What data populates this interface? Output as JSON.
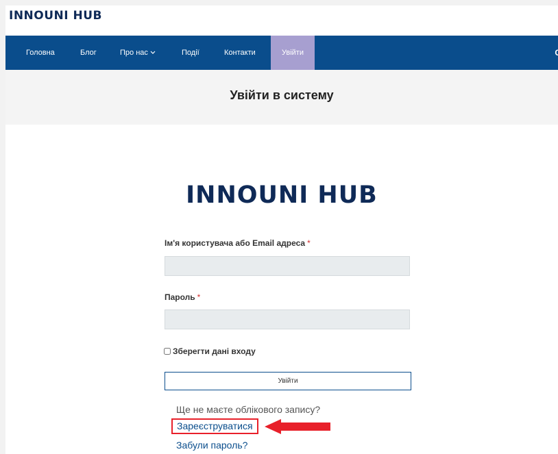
{
  "header": {
    "brand": "INNOUNI HUB"
  },
  "nav": {
    "items": [
      {
        "label": "Головна"
      },
      {
        "label": "Блог"
      },
      {
        "label": "Про нас"
      },
      {
        "label": "Події"
      },
      {
        "label": "Контакти"
      },
      {
        "label": "Увійти"
      }
    ],
    "overflow_text": "С"
  },
  "page": {
    "title": "Увійти в систему"
  },
  "login": {
    "logo": "INNOUNI HUB",
    "username_label": "Ім'я користувача або Email адреса",
    "username_value": "",
    "password_label": "Пароль",
    "password_value": "",
    "required_mark": "*",
    "remember_label": "Зберегти дані входу",
    "remember_checked": false,
    "submit_label": "Увійти",
    "no_account_text": "Ще не маєте облікового запису?",
    "register_label": "Зареєструватися",
    "forgot_label": "Забули пароль?"
  },
  "colors": {
    "nav_bg": "#0a4d8c",
    "nav_active_bg": "#a79fd0",
    "brand": "#0f2a57",
    "annotation_red": "#e8202a",
    "link": "#0a4d8c"
  },
  "icons": {
    "nav_dropdown": "chevron-down-icon",
    "annotation": "arrow-left-icon"
  }
}
